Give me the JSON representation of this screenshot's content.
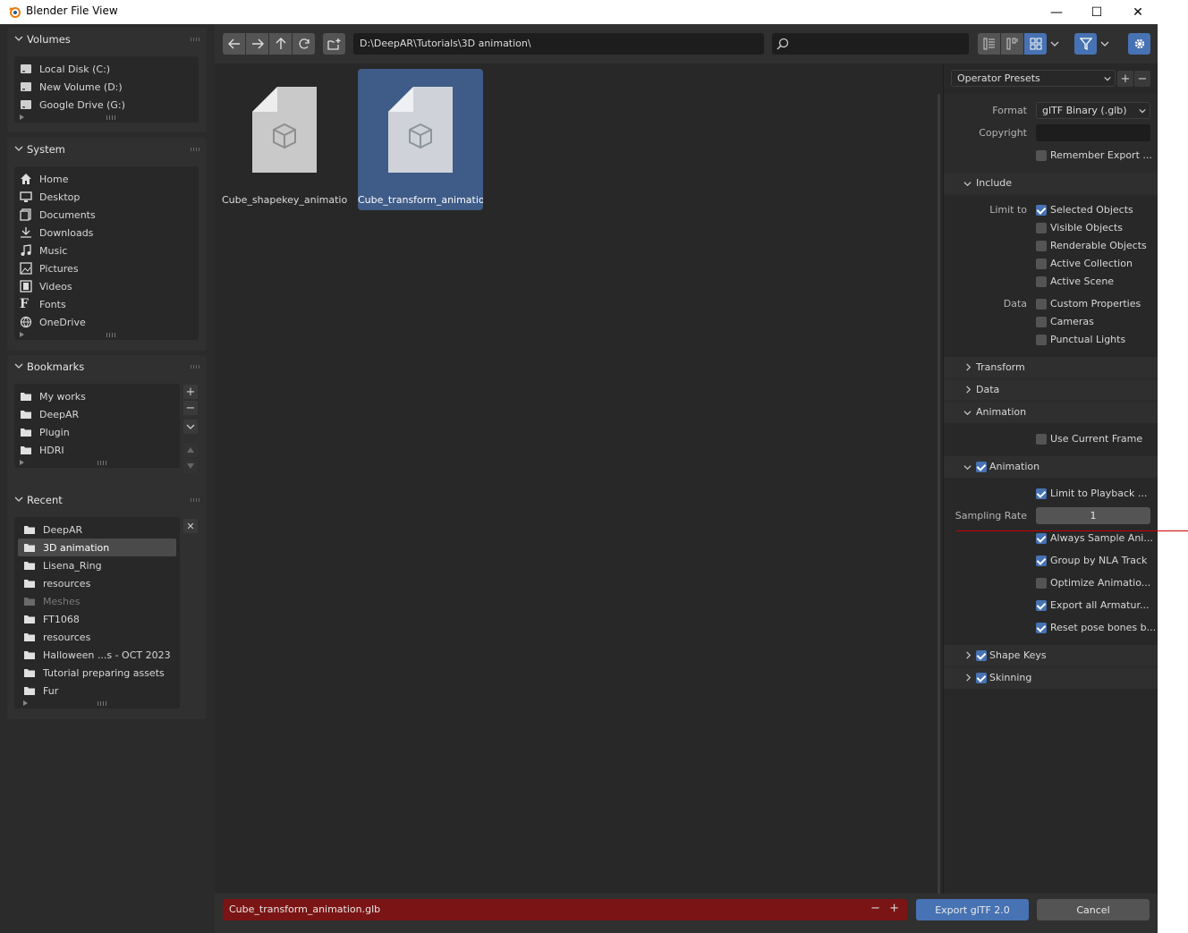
{
  "window": {
    "title": "Blender File View",
    "min": "—",
    "max": "☐",
    "close": "✕"
  },
  "colors": {
    "accent": "#4772b3",
    "filename_bg": "#7b1414",
    "selected": "#3f5b87"
  },
  "sidebar": {
    "volumes": {
      "title": "Volumes",
      "items": [
        "Local Disk (C:)",
        "New Volume (D:)",
        "Google Drive (G:)"
      ]
    },
    "system": {
      "title": "System",
      "items": [
        "Home",
        "Desktop",
        "Documents",
        "Downloads",
        "Music",
        "Pictures",
        "Videos",
        "Fonts",
        "OneDrive"
      ]
    },
    "bookmarks": {
      "title": "Bookmarks",
      "items": [
        "My works",
        "DeepAR",
        "Plugin",
        "HDRI"
      ],
      "add": "+",
      "remove": "−"
    },
    "recent": {
      "title": "Recent",
      "items": [
        "DeepAR",
        "3D animation",
        "Lisena_Ring",
        "resources",
        "Meshes",
        "FT1068",
        "resources",
        "Halloween ...s - OCT 2023",
        "Tutorial preparing assets",
        "Fur"
      ],
      "selected_index": 1,
      "clear": "✕"
    }
  },
  "toolbar": {
    "path": "D:\\DeepAR\\Tutorials\\3D animation\\",
    "search_placeholder": ""
  },
  "files": [
    {
      "name": "Cube_shapekey_animatio...",
      "selected": false
    },
    {
      "name": "Cube_transform_animatio...",
      "selected": true
    }
  ],
  "props": {
    "operator_presets": "Operator Presets",
    "format_label": "Format",
    "format_value": "glTF Binary (.glb)",
    "copyright_label": "Copyright",
    "copyright_value": "",
    "remember_export": "Remember Export ...",
    "include": {
      "title": "Include",
      "limit_to_label": "Limit to",
      "limit_to": [
        {
          "label": "Selected Objects",
          "checked": true
        },
        {
          "label": "Visible Objects",
          "checked": false
        },
        {
          "label": "Renderable Objects",
          "checked": false
        },
        {
          "label": "Active Collection",
          "checked": false
        },
        {
          "label": "Active Scene",
          "checked": false
        }
      ],
      "data_label": "Data",
      "data": [
        {
          "label": "Custom Properties",
          "checked": false
        },
        {
          "label": "Cameras",
          "checked": false
        },
        {
          "label": "Punctual Lights",
          "checked": false
        }
      ]
    },
    "transform_title": "Transform",
    "data_title": "Data",
    "animation_title": "Animation",
    "use_current_frame": "Use Current Frame",
    "animation_sub": {
      "title": "Animation",
      "limit_to_playback": "Limit to Playback ...",
      "sampling_rate_label": "Sampling Rate",
      "sampling_rate_value": "1",
      "options": [
        {
          "label": "Always Sample Ani...",
          "checked": true
        },
        {
          "label": "Group by NLA Track",
          "checked": true
        },
        {
          "label": "Optimize Animatio...",
          "checked": false
        },
        {
          "label": "Export all Armatur...",
          "checked": true
        },
        {
          "label": "Reset pose bones b...",
          "checked": true
        }
      ]
    },
    "shape_keys": "Shape Keys",
    "skinning": "Skinning"
  },
  "bottom": {
    "filename": "Cube_transform_animation.glb",
    "minus": "−",
    "plus": "+",
    "export": "Export glTF 2.0",
    "cancel": "Cancel"
  }
}
